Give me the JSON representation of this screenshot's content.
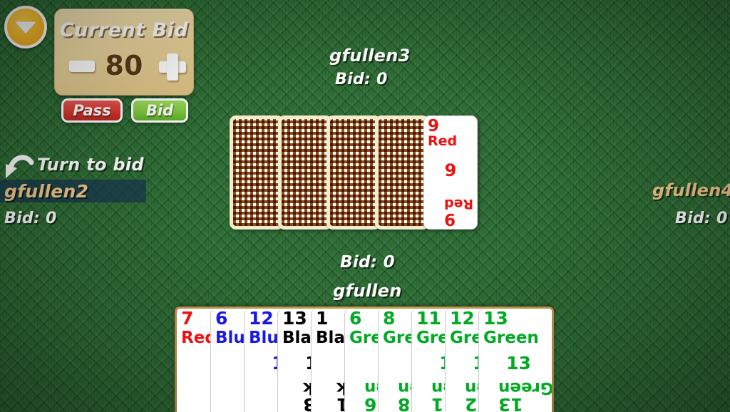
{
  "menu": {
    "icon": "chevron-down-icon"
  },
  "bid_panel": {
    "title": "Current Bid",
    "value": "80",
    "minus_label": "−",
    "plus_label": "+",
    "pass_label": "Pass",
    "bid_label": "Bid"
  },
  "turn": {
    "arrow_icon": "curved-arrow-icon",
    "label": "Turn to bid",
    "highlight_color": "#163452"
  },
  "players": {
    "left": {
      "name": "gfullen2",
      "bid": "Bid: 0",
      "name_color": "#f2c88a",
      "active": true
    },
    "top": {
      "name": "gfullen3",
      "bid": "Bid: 0",
      "name_color": "#ffffff",
      "active": false
    },
    "right": {
      "name": "gfullen4",
      "bid": "Bid: 0",
      "name_color": "#f2c88a",
      "active": false
    },
    "self": {
      "name": "gfullen",
      "bid": "Bid: 0",
      "name_color": "#ffffff",
      "active": false
    }
  },
  "trick": {
    "back_count": 4,
    "face_card": {
      "number": "9",
      "color_name": "Red",
      "color": "#ee1111"
    }
  },
  "hand": {
    "cards": [
      {
        "number": "7",
        "color_name": "Red",
        "color": "#ee1111"
      },
      {
        "number": "6",
        "color_name": "Blue",
        "color": "#1a1ae8"
      },
      {
        "number": "12",
        "color_name": "Blue",
        "color": "#1a1ae8"
      },
      {
        "number": "13",
        "color_name": "Black",
        "color": "#000000"
      },
      {
        "number": "1",
        "color_name": "Black",
        "color": "#000000"
      },
      {
        "number": "6",
        "color_name": "Green",
        "color": "#00aa22"
      },
      {
        "number": "8",
        "color_name": "Green",
        "color": "#00aa22"
      },
      {
        "number": "11",
        "color_name": "Green",
        "color": "#00aa22"
      },
      {
        "number": "12",
        "color_name": "Green",
        "color": "#00aa22"
      },
      {
        "number": "13",
        "color_name": "Green",
        "color": "#00aa22"
      }
    ]
  }
}
